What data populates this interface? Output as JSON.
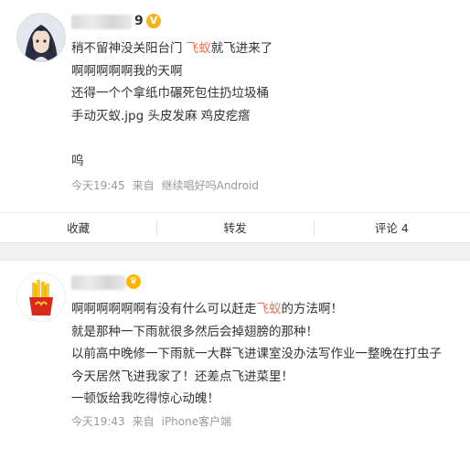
{
  "post": {
    "author_suffix": "9",
    "verified_icon": "v-badge-icon",
    "lines": [
      {
        "before": "稍不留神没关阳台门 ",
        "highlight": "飞蚁",
        "after": "就飞进来了"
      },
      {
        "text": "啊啊啊啊啊我的天啊"
      },
      {
        "text": "还得一个个拿纸巾碾死包住扔垃圾桶"
      },
      {
        "text": "手动灭蚁.jpg 头皮发麻 鸡皮疙瘩"
      },
      {
        "text": ""
      },
      {
        "text": "呜"
      }
    ],
    "time": "今天19:45",
    "from_label": "来自",
    "source": "继续唱好吗Android"
  },
  "actions": {
    "collect": "收藏",
    "repost": "转发",
    "comment": "评论 4"
  },
  "comment": {
    "badge_icon": "crown-icon",
    "lines": [
      {
        "before": "啊啊啊啊啊啊有没有什么可以赶走",
        "highlight": "飞蚁",
        "after": "的方法啊！"
      },
      {
        "text": "就是那种一下雨就很多然后会掉翅膀的那种！"
      },
      {
        "text": "以前高中晚修一下雨就一大群飞进课室没办法写作业一整晚在打虫子"
      },
      {
        "text": "今天居然飞进我家了！还差点飞进菜里！"
      },
      {
        "text": "一顿饭给我吃得惊心动魄！"
      }
    ],
    "time": "今天19:43",
    "from_label": "来自",
    "source": "iPhone客户端"
  },
  "colors": {
    "highlight": "#eb7350",
    "badge": "#f7b21c",
    "meta": "#999999"
  }
}
